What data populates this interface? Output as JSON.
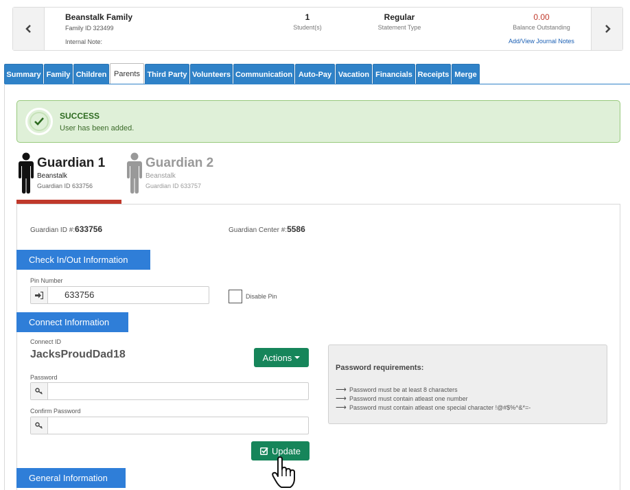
{
  "family": {
    "name": "Beanstalk Family",
    "family_id": "Family ID 323499",
    "internal_note": "Internal Note:",
    "students_value": "1",
    "students_label": "Student(s)",
    "statement_value": "Regular",
    "statement_label": "Statement Type",
    "balance_value": "0.00",
    "balance_label": "Balance Outstanding",
    "journal_link": "Add/View Journal Notes",
    "prev_icon": "chevron-left-icon",
    "next_icon": "chevron-right-icon"
  },
  "tabs": [
    {
      "label": "Summary",
      "active": false
    },
    {
      "label": "Family",
      "active": false
    },
    {
      "label": "Children",
      "active": false
    },
    {
      "label": "Parents",
      "active": true
    },
    {
      "label": "Third Party",
      "active": false
    },
    {
      "label": "Volunteers",
      "active": false
    },
    {
      "label": "Communication",
      "active": false
    },
    {
      "label": "Auto-Pay",
      "active": false
    },
    {
      "label": "Vacation",
      "active": false
    },
    {
      "label": "Financials",
      "active": false
    },
    {
      "label": "Receipts",
      "active": false
    },
    {
      "label": "Merge",
      "active": false
    }
  ],
  "alert": {
    "title": "SUCCESS",
    "message": "User has been added.",
    "icon": "check-circle-icon"
  },
  "guardians": [
    {
      "title": "Guardian 1",
      "last_name": "Beanstalk",
      "id_text": "Guardian ID 633756",
      "active": true
    },
    {
      "title": "Guardian 2",
      "last_name": "Beanstalk",
      "id_text": "Guardian ID 633757",
      "active": false
    }
  ],
  "guardian_info": {
    "id_label": "Guardian ID #:",
    "id_value": "633756",
    "center_label": "Guardian Center #:",
    "center_value": "5586"
  },
  "checkin": {
    "header": "Check In/Out Information",
    "pin_label": "Pin Number",
    "pin_value": "633756",
    "disable_pin_label": "Disable Pin"
  },
  "connect": {
    "header": "Connect Information",
    "id_label": "Connect ID",
    "id_value": "JacksProudDad18",
    "actions_label": "Actions",
    "password_label": "Password",
    "password_value": "",
    "confirm_label": "Confirm Password",
    "confirm_value": "",
    "update_label": "Update"
  },
  "password_requirements": {
    "title": "Password requirements:",
    "items": [
      "Password must be at least 8 characters",
      "Password must contain atleast one number",
      "Password must contain atleast one special character !@#$%^&*=-"
    ]
  },
  "general": {
    "header": "General Information"
  },
  "colors": {
    "tab_blue": "#2f82c8",
    "section_blue": "#2f7ed8",
    "green_button": "#16855a",
    "success_bg": "#dff0d8",
    "active_underline": "#c0392b",
    "balance_red": "#c0392b"
  }
}
